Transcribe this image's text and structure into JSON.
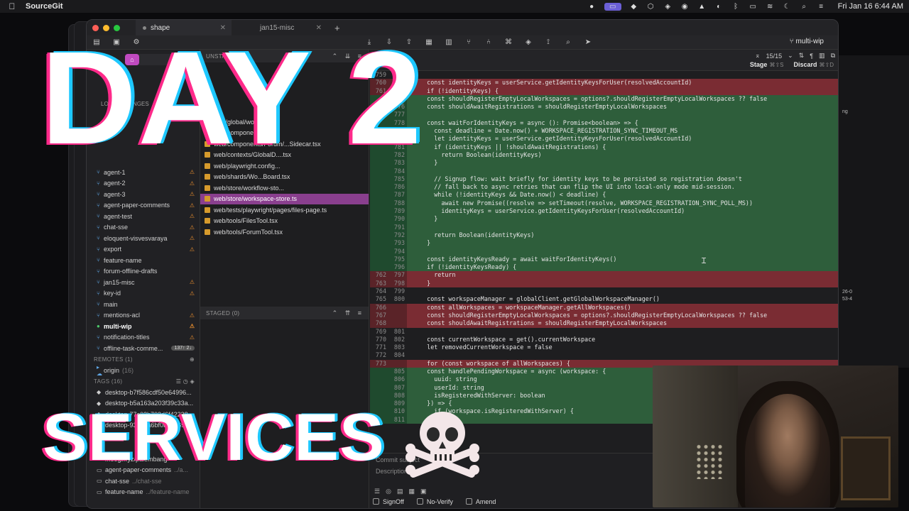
{
  "menubar": {
    "app_name": "SourceGit",
    "clock": "Fri Jan 16  6:44 AM"
  },
  "window": {
    "tabs": [
      {
        "label": "shape",
        "active": true
      },
      {
        "label": "jan15-misc",
        "active": false
      }
    ],
    "current_branch": "multi-wip"
  },
  "sidebar": {
    "local_changes_label": "LOCAL CHANGES",
    "branches": [
      {
        "name": "agent-1",
        "warn": true
      },
      {
        "name": "agent-2",
        "warn": true
      },
      {
        "name": "agent-3",
        "warn": true
      },
      {
        "name": "agent-paper-comments",
        "warn": true
      },
      {
        "name": "agent-test",
        "warn": true
      },
      {
        "name": "chat-sse",
        "warn": true
      },
      {
        "name": "eloquent-visvesvaraya",
        "warn": true
      },
      {
        "name": "export",
        "warn": true
      },
      {
        "name": "feature-name",
        "warn": false
      },
      {
        "name": "forum-offline-drafts",
        "warn": false
      },
      {
        "name": "jan15-misc",
        "warn": true
      },
      {
        "name": "key-id",
        "warn": true
      },
      {
        "name": "main",
        "warn": false
      },
      {
        "name": "mentions-acl",
        "warn": true
      },
      {
        "name": "multi-wip",
        "warn": true,
        "current": true
      },
      {
        "name": "notification-titles",
        "warn": true
      },
      {
        "name": "offline-task-comme...",
        "warn": false,
        "badge": "137↑ 2↓"
      }
    ],
    "remotes_header": "REMOTES (1)",
    "remotes": [
      {
        "name": "origin",
        "count": "(16)"
      }
    ],
    "tags_header": "TAGS (16)",
    "tags": [
      "desktop-b7f586cdf50e64996...",
      "desktop-b5a163a203f39c33a...",
      "desktop-77c02b703d6f42238...",
      "desktop-93577a6bf0b86b695..."
    ],
    "worktrees": [
      {
        "name": "moogi/xyz/palembang",
        "path": ""
      },
      {
        "name": "agent-paper-comments",
        "path": "../a..."
      },
      {
        "name": "chat-sse",
        "path": "../chat-sse"
      },
      {
        "name": "feature-name",
        "path": "../feature-name"
      }
    ]
  },
  "filepane": {
    "unstaged_header": "UNSTAGED",
    "files": [
      "web/global/wo...",
      "web/components/B...",
      "web/components/Forum/...Sidecar.tsx",
      "web/contexts/GlobalD....tsx",
      "web/playwright.config...",
      "web/shards/Wo...Board.tsx",
      "web/store/workflow-sto...",
      "web/store/workspace-store.ts",
      "web/tests/playwright/pages/files-page.ts",
      "web/tools/FilesTool.tsx",
      "web/tools/ForumTool.tsx"
    ],
    "selected_index": 7,
    "staged_header": "STAGED (0)",
    "commit_placeholder": "Commit subject",
    "description_placeholder": "Description"
  },
  "diff": {
    "path": "web/s...",
    "nav": "15/15",
    "stage_label": "Stage",
    "stage_kbd": "⌘⇧S",
    "discard_label": "Discard",
    "discard_kbd": "⌘⇧D",
    "lines": [
      {
        "o": "759",
        "n": "",
        "t": "ctx",
        "c": ""
      },
      {
        "o": "760",
        "n": "",
        "t": "del",
        "c": "    const identityKeys = userService.getIdentityKeysForUser(resolvedAccountId)"
      },
      {
        "o": "761",
        "n": "",
        "t": "del",
        "c": "    if (!identityKeys) {"
      },
      {
        "o": "",
        "n": "775",
        "t": "add",
        "c": "    const shouldRegisterEmptyLocalWorkspaces = options?.shouldRegisterEmptyLocalWorkspaces ?? false"
      },
      {
        "o": "",
        "n": "776",
        "t": "add",
        "c": "    const shouldAwaitRegistrations = shouldRegisterEmptyLocalWorkspaces"
      },
      {
        "o": "",
        "n": "777",
        "t": "add",
        "c": ""
      },
      {
        "o": "",
        "n": "778",
        "t": "add",
        "c": "    const waitForIdentityKeys = async (): Promise<boolean> => {"
      },
      {
        "o": "",
        "n": "779",
        "t": "add",
        "c": "      const deadline = Date.now() + WORKSPACE_REGISTRATION_SYNC_TIMEOUT_MS"
      },
      {
        "o": "",
        "n": "780",
        "t": "add",
        "c": "      let identityKeys = userService.getIdentityKeysForUser(resolvedAccountId)"
      },
      {
        "o": "",
        "n": "781",
        "t": "add",
        "c": "      if (identityKeys || !shouldAwaitRegistrations) {"
      },
      {
        "o": "",
        "n": "782",
        "t": "add",
        "c": "        return Boolean(identityKeys)"
      },
      {
        "o": "",
        "n": "783",
        "t": "add",
        "c": "      }"
      },
      {
        "o": "",
        "n": "784",
        "t": "add",
        "c": ""
      },
      {
        "o": "",
        "n": "785",
        "t": "add",
        "c": "      // Signup flow: wait briefly for identity keys to be persisted so registration doesn't"
      },
      {
        "o": "",
        "n": "786",
        "t": "add",
        "c": "      // fall back to async retries that can flip the UI into local-only mode mid-session."
      },
      {
        "o": "",
        "n": "787",
        "t": "add",
        "c": "      while (!identityKeys && Date.now() < deadline) {"
      },
      {
        "o": "",
        "n": "788",
        "t": "add",
        "c": "        await new Promise((resolve => setTimeout(resolve, WORKSPACE_REGISTRATION_SYNC_POLL_MS))"
      },
      {
        "o": "",
        "n": "789",
        "t": "add",
        "c": "        identityKeys = userService.getIdentityKeysForUser(resolvedAccountId)"
      },
      {
        "o": "",
        "n": "790",
        "t": "add",
        "c": "      }"
      },
      {
        "o": "",
        "n": "791",
        "t": "add",
        "c": ""
      },
      {
        "o": "",
        "n": "792",
        "t": "add",
        "c": "      return Boolean(identityKeys)"
      },
      {
        "o": "",
        "n": "793",
        "t": "add",
        "c": "    }"
      },
      {
        "o": "",
        "n": "794",
        "t": "add",
        "c": ""
      },
      {
        "o": "",
        "n": "795",
        "t": "add",
        "c": "    const identityKeysReady = await waitForIdentityKeys()"
      },
      {
        "o": "",
        "n": "796",
        "t": "add",
        "c": "    if (!identityKeysReady) {"
      },
      {
        "o": "762",
        "n": "797",
        "t": "del",
        "c": "      return"
      },
      {
        "o": "763",
        "n": "798",
        "t": "del",
        "c": "    }"
      },
      {
        "o": "764",
        "n": "799",
        "t": "ctx",
        "c": ""
      },
      {
        "o": "765",
        "n": "800",
        "t": "ctx",
        "c": "    const workspaceManager = globalClient.getGlobalWorkspaceManager()"
      },
      {
        "o": "766",
        "n": "",
        "t": "del",
        "c": "    const allWorkspaces = workspaceManager.getAllWorkspaces()"
      },
      {
        "o": "767",
        "n": "",
        "t": "del",
        "c": "    const shouldRegisterEmptyLocalWorkspaces = options?.shouldRegisterEmptyLocalWorkspaces ?? false"
      },
      {
        "o": "768",
        "n": "",
        "t": "del",
        "c": "    const shouldAwaitRegistrations = shouldRegisterEmptyLocalWorkspaces"
      },
      {
        "o": "769",
        "n": "801",
        "t": "ctx",
        "c": ""
      },
      {
        "o": "770",
        "n": "802",
        "t": "ctx",
        "c": "    const currentWorkspace = get().currentWorkspace"
      },
      {
        "o": "771",
        "n": "803",
        "t": "ctx",
        "c": "    let removedCurrentWorkspace = false"
      },
      {
        "o": "772",
        "n": "804",
        "t": "ctx",
        "c": ""
      },
      {
        "o": "773",
        "n": "",
        "t": "del",
        "c": "    for (const workspace of allWorkspaces) {"
      },
      {
        "o": "",
        "n": "805",
        "t": "add",
        "c": "    const handlePendingWorkspace = async (workspace: {"
      },
      {
        "o": "",
        "n": "806",
        "t": "add",
        "c": "      uuid: string"
      },
      {
        "o": "",
        "n": "807",
        "t": "add",
        "c": "      userId: string"
      },
      {
        "o": "",
        "n": "808",
        "t": "add",
        "c": "      isRegisteredWithServer: boolean"
      },
      {
        "o": "",
        "n": "809",
        "t": "add",
        "c": "    }) => {"
      },
      {
        "o": "",
        "n": "810",
        "t": "add",
        "c": "      if (workspace.isRegisteredWithServer) {"
      },
      {
        "o": "",
        "n": "811",
        "t": "add",
        "c": ""
      }
    ],
    "checks": [
      {
        "label": "SignOff"
      },
      {
        "label": "No-Verify"
      },
      {
        "label": "Amend"
      }
    ]
  },
  "overlay": {
    "title": "DAY 2",
    "subtitle": "SERVICES",
    "emoji": "skull-and-crossbones"
  }
}
